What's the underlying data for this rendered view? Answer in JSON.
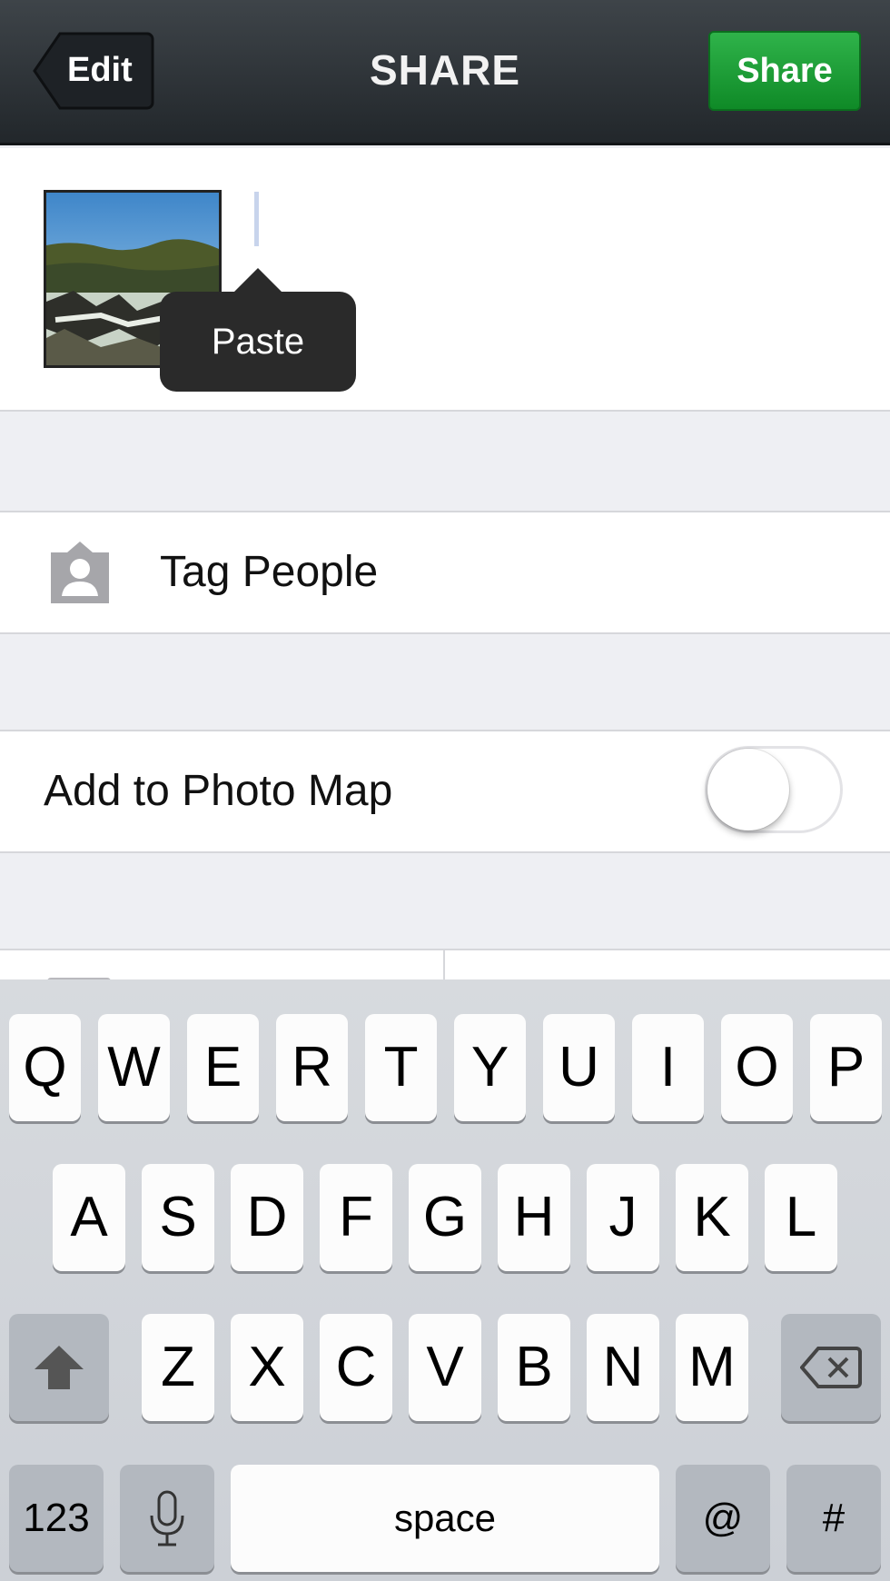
{
  "nav": {
    "back_label": "Edit",
    "title": "SHARE",
    "action_label": "Share"
  },
  "caption": {
    "paste_label": "Paste"
  },
  "options": {
    "tag_people_label": "Tag People",
    "photo_map_label": "Add to Photo Map",
    "photo_map_enabled": false
  },
  "keyboard": {
    "row1": [
      "Q",
      "W",
      "E",
      "R",
      "T",
      "Y",
      "U",
      "I",
      "O",
      "P"
    ],
    "row2": [
      "A",
      "S",
      "D",
      "F",
      "G",
      "H",
      "J",
      "K",
      "L"
    ],
    "row3": [
      "Z",
      "X",
      "C",
      "V",
      "B",
      "N",
      "M"
    ],
    "numbers_label": "123",
    "space_label": "space",
    "at_label": "@",
    "hash_label": "#"
  },
  "colors": {
    "share_green": "#1aa037",
    "navbar": "#2c3135",
    "keyboard_bg": "#d2d5da"
  }
}
